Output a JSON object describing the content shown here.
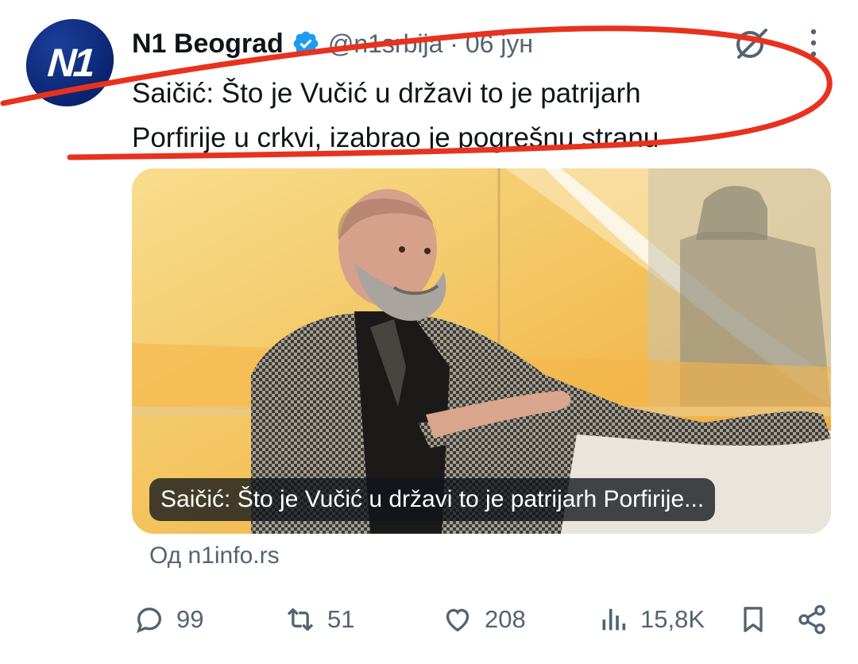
{
  "tweet": {
    "avatar_label": "N1",
    "author_name": "N1 Beograd",
    "handle_date": "@n1srbija · 06 јун",
    "text_lines": [
      "Saičić: Što je Vučić u državi to je patrijarh",
      "Porfirije u crkvi, izabrao je pogrešnu stranu"
    ]
  },
  "card": {
    "caption": "Saičić: Što je Vučić u državi to je patrijarh Porfirije...",
    "source": "Од n1info.rs"
  },
  "actions": {
    "replies": "99",
    "reposts": "51",
    "likes": "208",
    "views": "15,8K"
  },
  "icons": [
    "verified-badge-icon",
    "grok-icon",
    "more-icon",
    "reply-icon",
    "repost-icon",
    "like-icon",
    "views-icon",
    "bookmark-icon",
    "share-icon"
  ],
  "colors": {
    "verified": "#1d9bf0",
    "annotation": "#e8321e",
    "secondary_text": "#536471",
    "brand": "#0b2470"
  }
}
